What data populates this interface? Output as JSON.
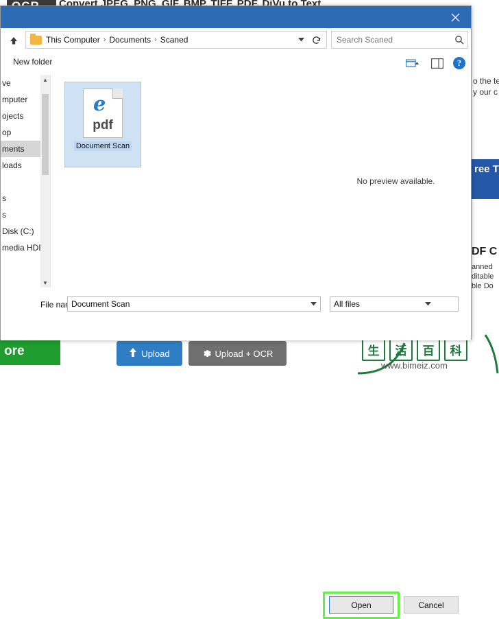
{
  "background": {
    "logo": "OCR",
    "headline": "Convert JPEG, PNG, GIF, BMP, TIFF, PDF, DjVu to Text",
    "left_nav": [
      {
        "label": "ve",
        "selected": false
      },
      {
        "label": "mputer",
        "selected": false
      },
      {
        "label": "ojects",
        "selected": false
      },
      {
        "label": "op",
        "selected": false
      },
      {
        "label": "ments",
        "selected": true
      },
      {
        "label": "loads",
        "selected": false
      }
    ],
    "right_text_lines": [
      "o the te",
      "y our c"
    ],
    "blue_box_text": "ree T",
    "right_heading": "DF C",
    "right_body": [
      "anned",
      "ditable",
      "ble Do"
    ],
    "green_button": "ore",
    "upload_button": "Upload",
    "upload_ocr_button": "Upload + OCR",
    "watermark_chars": [
      "生",
      "活",
      "百",
      "科"
    ],
    "watermark_url": "www.bimeiz.com"
  },
  "dialog": {
    "title": "",
    "close_label": "✕",
    "breadcrumb": [
      "This Computer",
      "Documents",
      "Scaned"
    ],
    "breadcrumb_separator": "›",
    "search": {
      "value": "",
      "placeholder": "Search Scaned"
    },
    "toolbar": {
      "new_folder": "New folder",
      "view_icon": "view-layout-icon",
      "pane_icon": "preview-pane-icon",
      "help_icon": "?"
    },
    "nav_pane": {
      "items": [
        {
          "label": "ve",
          "selected": false
        },
        {
          "label": "mputer",
          "selected": false
        },
        {
          "label": "ojects",
          "selected": false
        },
        {
          "label": "op",
          "selected": false
        },
        {
          "label": "ments",
          "selected": true
        },
        {
          "label": "loads",
          "selected": false
        },
        {
          "label": "",
          "selected": false
        },
        {
          "label": "s",
          "selected": false
        },
        {
          "label": "s",
          "selected": false
        },
        {
          "label": "Disk (C:)",
          "selected": false
        },
        {
          "label": "media HDD",
          "selected": false
        }
      ]
    },
    "files": [
      {
        "name": "Document Scan",
        "type": "pdf",
        "badge": "pdf",
        "glyph": "e",
        "selected": true
      }
    ],
    "preview": {
      "message": "No preview available."
    },
    "footer": {
      "file_name_label": "File name:",
      "file_name_value": "Document Scan",
      "file_type_value": "All files",
      "open_button": "Open",
      "cancel_button": "Cancel"
    }
  }
}
